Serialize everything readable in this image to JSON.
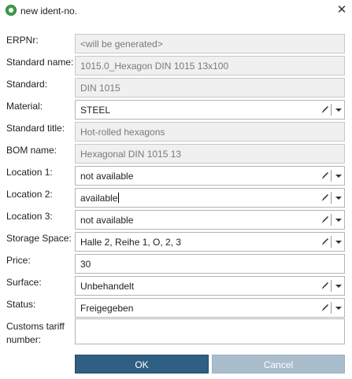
{
  "window": {
    "title": "new ident-no.",
    "close_glyph": "✕",
    "app_icon": "green-gear-icon"
  },
  "fields": {
    "erpnr": {
      "label": "ERPNr:",
      "value": "<will be generated>"
    },
    "standard_name": {
      "label": "Standard name:",
      "value": "1015.0_Hexagon DIN 1015 13x100"
    },
    "standard": {
      "label": "Standard:",
      "value": "DIN 1015"
    },
    "material": {
      "label": "Material:",
      "value": "STEEL"
    },
    "standard_title": {
      "label": "Standard title:",
      "value": "Hot-rolled hexagons"
    },
    "bom_name": {
      "label": "BOM name:",
      "value": "Hexagonal DIN 1015 13"
    },
    "location1": {
      "label": "Location 1:",
      "value": "not available"
    },
    "location2": {
      "label": "Location 2:",
      "value": "available"
    },
    "location3": {
      "label": "Location 3:",
      "value": "not available"
    },
    "storage_space": {
      "label": "Storage Space:",
      "value": "Halle 2, Reihe 1, O, 2, 3"
    },
    "price": {
      "label": "Price:",
      "value": "30"
    },
    "surface": {
      "label": "Surface:",
      "value": "Unbehandelt"
    },
    "status": {
      "label": "Status:",
      "value": "Freigegeben"
    },
    "customs_tariff": {
      "label_line1": "Customs tariff",
      "label_line2": "number:",
      "value": ""
    }
  },
  "buttons": {
    "ok": "OK",
    "cancel": "Cancel"
  },
  "colors": {
    "ok_button": "#305f84",
    "cancel_button": "#a9bdcd",
    "readonly_field": "#f0f0f0"
  }
}
